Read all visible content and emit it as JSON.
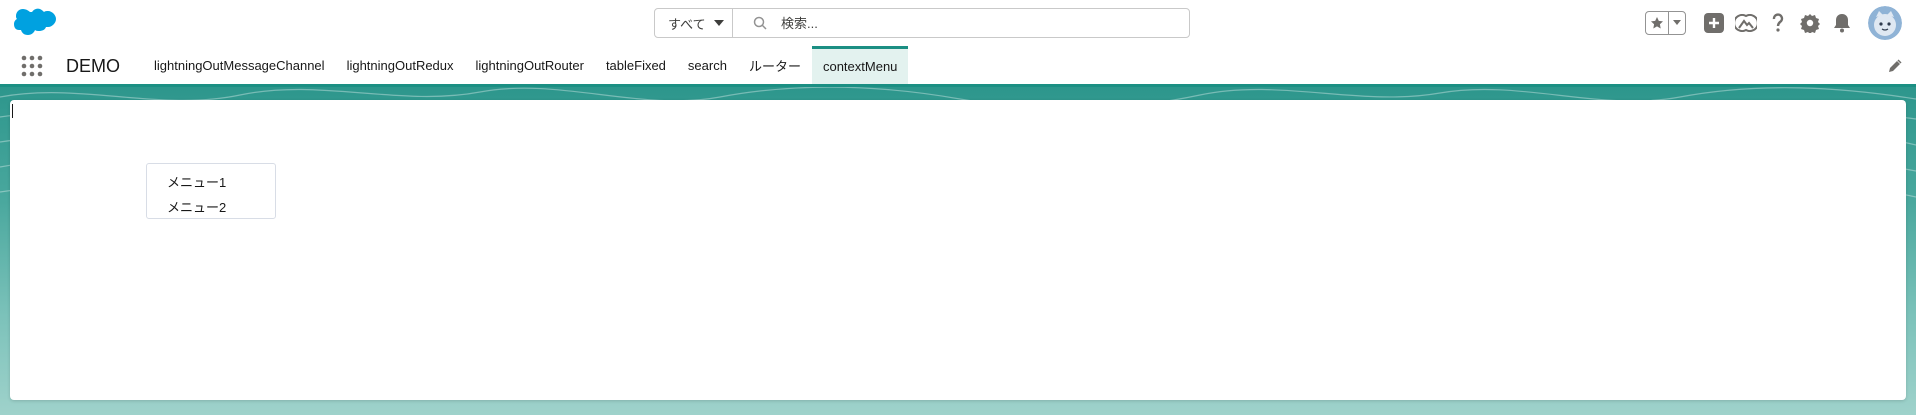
{
  "header": {
    "search": {
      "scope_label": "すべて",
      "placeholder": "検索..."
    }
  },
  "nav": {
    "app_name": "DEMO",
    "tabs": [
      {
        "label": "lightningOutMessageChannel"
      },
      {
        "label": "lightningOutRedux"
      },
      {
        "label": "lightningOutRouter"
      },
      {
        "label": "tableFixed"
      },
      {
        "label": "search"
      },
      {
        "label": "ルーター"
      },
      {
        "label": "contextMenu"
      }
    ],
    "active_tab": "contextMenu"
  },
  "context_menu": {
    "items": [
      {
        "label": "メニュー1"
      },
      {
        "label": "メニュー2"
      }
    ]
  },
  "colors": {
    "brand_teal": "#1b8f83",
    "salesforce_blue": "#00a1e0",
    "icon_gray": "#706e6b"
  }
}
